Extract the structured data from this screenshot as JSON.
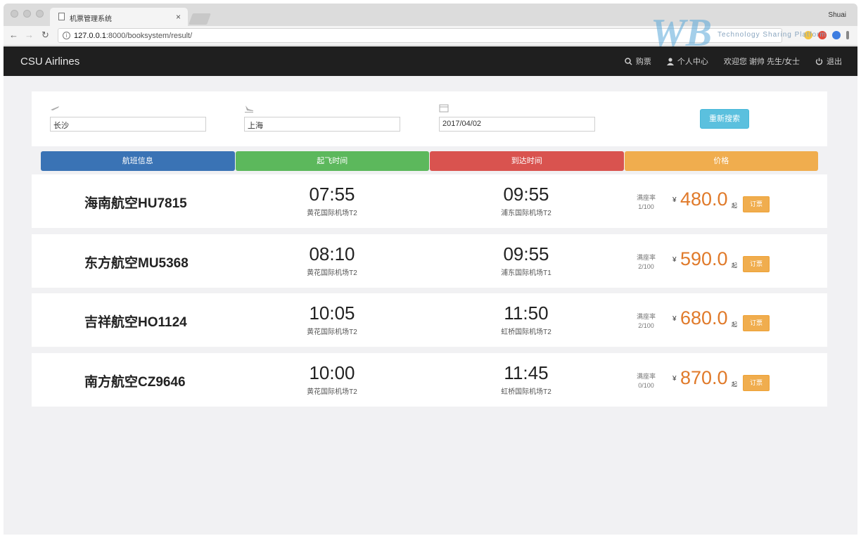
{
  "browser": {
    "tab_title": "机票管理系统",
    "tab_close": "×",
    "user_name": "Shuai",
    "url_host": "127.0.0.1",
    "url_rest": ":8000/booksystem/result/"
  },
  "navbar": {
    "brand": "CSU Airlines",
    "buy": "购票",
    "profile": "个人中心",
    "welcome": "欢迎您 谢帅 先生/女士",
    "logout": "退出"
  },
  "search": {
    "origin": "长沙",
    "destination": "上海",
    "date": "2017/04/02",
    "button": "重新搜索"
  },
  "headers": [
    {
      "label": "航班信息",
      "color": "#3a73b5"
    },
    {
      "label": "起飞时间",
      "color": "#5cb85c"
    },
    {
      "label": "到达时间",
      "color": "#d9534f"
    },
    {
      "label": "价格",
      "color": "#f0ad4e"
    }
  ],
  "flights": [
    {
      "name": "海南航空HU7815",
      "dep_time": "07:55",
      "dep_airport": "黄花国际机场T2",
      "arr_time": "09:55",
      "arr_airport": "浦东国际机场T2",
      "seat_label": "满座率",
      "seats": "1/100",
      "currency": "¥",
      "price": "480.0",
      "from": "起",
      "order": "订票"
    },
    {
      "name": "东方航空MU5368",
      "dep_time": "08:10",
      "dep_airport": "黄花国际机场T2",
      "arr_time": "09:55",
      "arr_airport": "浦东国际机场T1",
      "seat_label": "满座率",
      "seats": "2/100",
      "currency": "¥",
      "price": "590.0",
      "from": "起",
      "order": "订票"
    },
    {
      "name": "吉祥航空HO1124",
      "dep_time": "10:05",
      "dep_airport": "黄花国际机场T2",
      "arr_time": "11:50",
      "arr_airport": "虹桥国际机场T2",
      "seat_label": "满座率",
      "seats": "2/100",
      "currency": "¥",
      "price": "680.0",
      "from": "起",
      "order": "订票"
    },
    {
      "name": "南方航空CZ9646",
      "dep_time": "10:00",
      "dep_airport": "黄花国际机场T2",
      "arr_time": "11:45",
      "arr_airport": "虹桥国际机场T2",
      "seat_label": "满座率",
      "seats": "0/100",
      "currency": "¥",
      "price": "870.0",
      "from": "起",
      "order": "订票"
    }
  ],
  "watermark": {
    "text": "Technology Sharing Platform"
  }
}
